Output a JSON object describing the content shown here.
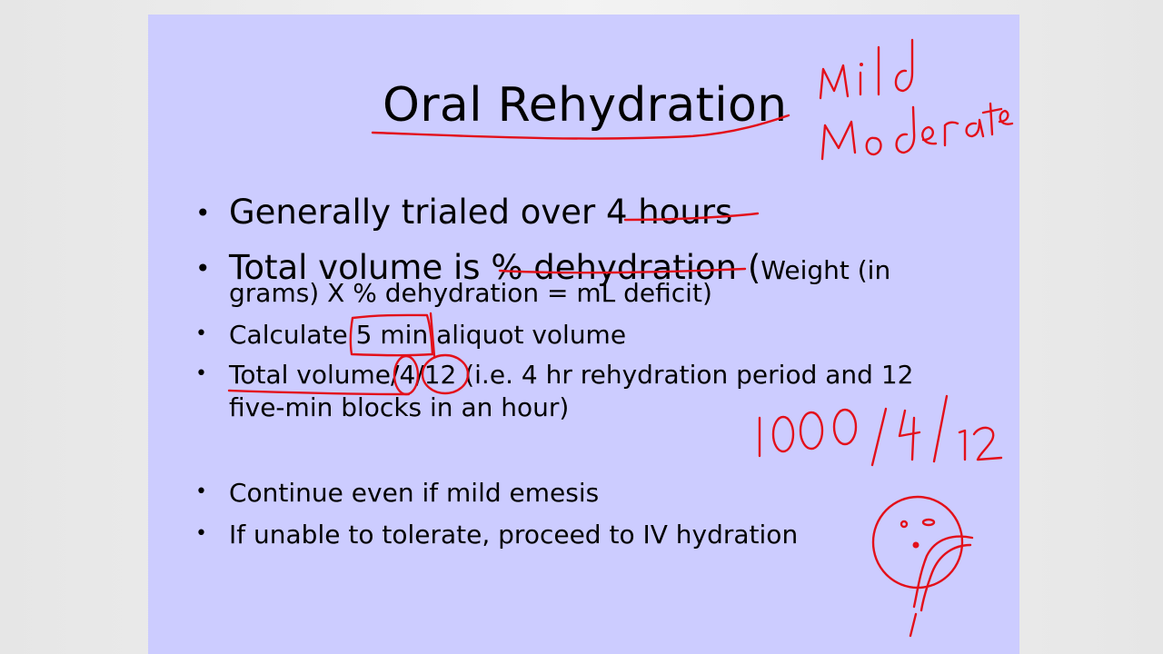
{
  "slide": {
    "title": "Oral Rehydration",
    "bullets": [
      {
        "marker": "•",
        "lines": [
          "Generally trialed over 4 hours"
        ]
      },
      {
        "marker": "•",
        "line1_main": "Total volume is % dehydration ",
        "line1_paren": "(",
        "line1_small": "Weight (in",
        "line2": "grams) X % dehydration = mL deficit)"
      },
      {
        "marker": "•",
        "lines": [
          "Calculate 5 min aliquot volume"
        ]
      },
      {
        "marker": "•",
        "lines": [
          "Total volume/4/12 (i.e. 4 hr rehydration period and 12",
          "five-min blocks in an hour)"
        ]
      },
      {
        "marker": "•",
        "lines": [
          "Continue even if mild emesis"
        ]
      },
      {
        "marker": "•",
        "lines": [
          "If unable to tolerate, proceed to IV hydration"
        ]
      }
    ]
  },
  "annotations": {
    "ink_color": "#e3101a",
    "handwritten_text": [
      "Mild",
      "Moderate",
      "1000/4/12"
    ]
  }
}
